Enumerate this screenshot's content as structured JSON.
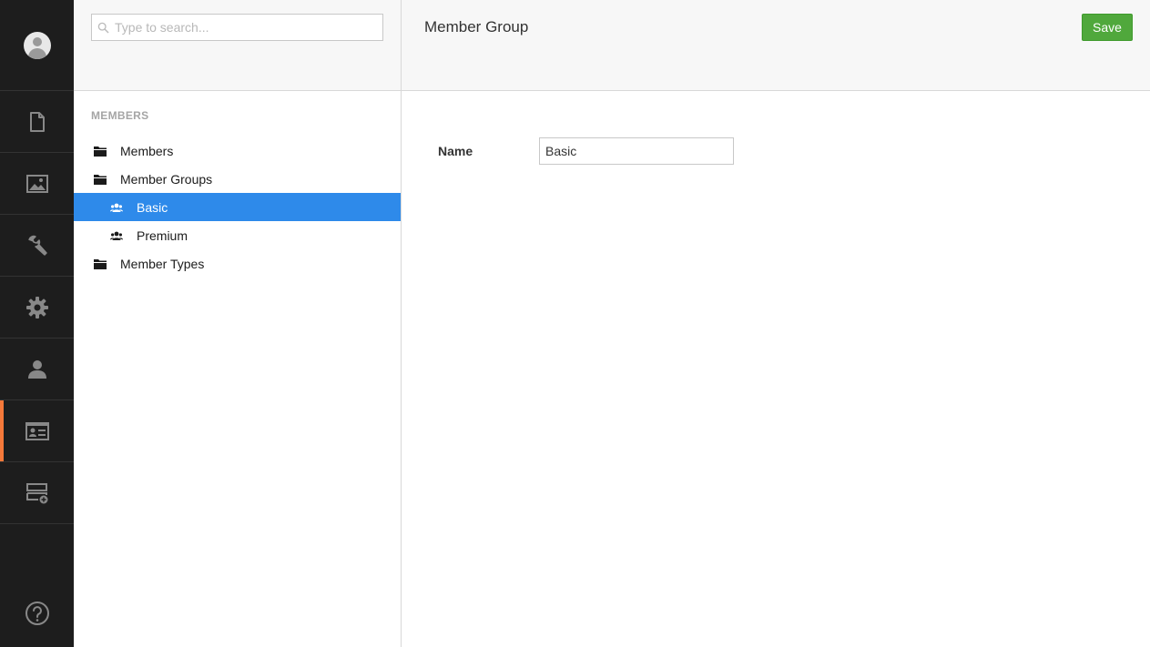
{
  "appbar": {
    "sections": [
      {
        "name": "content",
        "icon": "document-icon",
        "active": false
      },
      {
        "name": "media",
        "icon": "image-icon",
        "active": false
      },
      {
        "name": "settings",
        "icon": "wrench-icon",
        "active": false
      },
      {
        "name": "developer",
        "icon": "gear-icon",
        "active": false
      },
      {
        "name": "users",
        "icon": "user-icon",
        "active": false
      },
      {
        "name": "members",
        "icon": "id-card-icon",
        "active": true
      },
      {
        "name": "forms",
        "icon": "form-add-icon",
        "active": false
      }
    ],
    "help_icon": "help-icon",
    "accent_color": "#f5793a"
  },
  "search": {
    "placeholder": "Type to search..."
  },
  "tree": {
    "root_label": "MEMBERS",
    "items": [
      {
        "label": "Members",
        "icon": "folder-icon",
        "level": 1,
        "selected": false
      },
      {
        "label": "Member Groups",
        "icon": "folder-icon",
        "level": 1,
        "selected": false
      },
      {
        "label": "Basic",
        "icon": "users-icon",
        "level": 2,
        "selected": true
      },
      {
        "label": "Premium",
        "icon": "users-icon",
        "level": 2,
        "selected": false
      },
      {
        "label": "Member Types",
        "icon": "folder-icon",
        "level": 1,
        "selected": false
      }
    ],
    "selected_color": "#2e8aea"
  },
  "editor": {
    "title": "Member Group",
    "save_label": "Save",
    "save_color": "#50a83c",
    "fields": [
      {
        "label": "Name",
        "value": "Basic"
      }
    ]
  }
}
